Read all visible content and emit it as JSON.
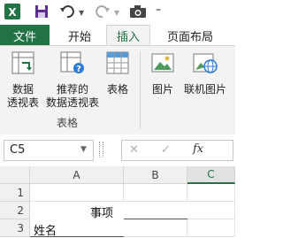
{
  "title_bar": {
    "app_icon_letter": "X",
    "save_icon": "save-icon",
    "undo_icon": "undo-icon",
    "redo_icon": "redo-icon",
    "camera_icon": "camera-icon"
  },
  "tabs": [
    {
      "label": "文件"
    },
    {
      "label": "开始"
    },
    {
      "label": "插入"
    },
    {
      "label": "页面布局"
    }
  ],
  "ribbon": {
    "pivot_table_line1": "数据",
    "pivot_table_line2": "透视表",
    "recommended_line1": "推荐的",
    "recommended_line2": "数据透视表",
    "table_label": "表格",
    "picture_label": "图片",
    "online_picture_label": "联机图片",
    "group_tables": "表格"
  },
  "formula_bar": {
    "name_box_value": "C5",
    "cancel_glyph": "✕",
    "enter_glyph": "✓",
    "fx_label": "fx"
  },
  "grid": {
    "columns": [
      "A",
      "B",
      "C"
    ],
    "rows": [
      "1",
      "2",
      "3"
    ],
    "cells": {
      "B2_text": "事项",
      "A3_text": "姓名"
    }
  },
  "colors": {
    "excel_green": "#217346",
    "ribbon_bg": "#f3f3f3"
  }
}
